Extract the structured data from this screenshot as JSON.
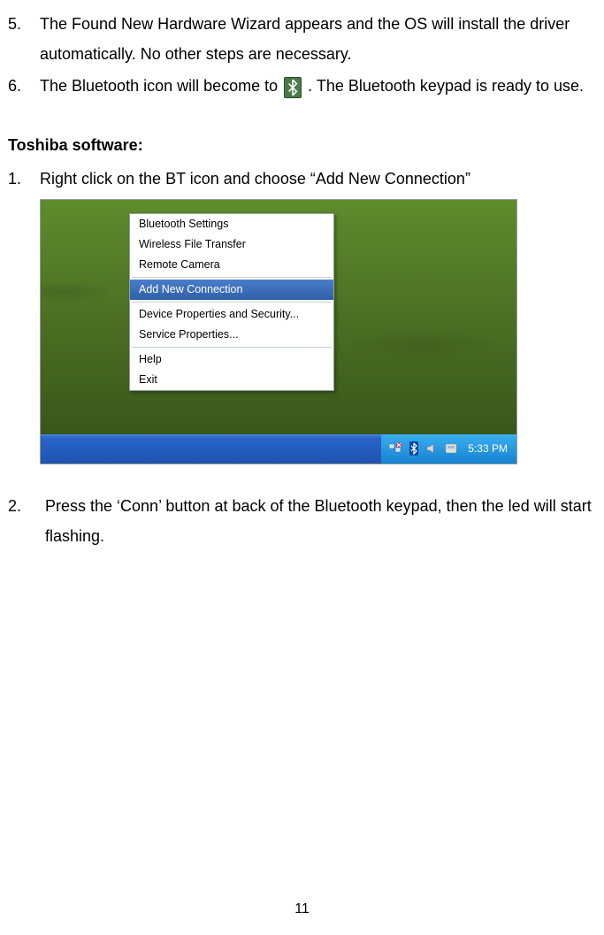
{
  "item5": {
    "num": "5.",
    "text": "The Found New Hardware Wizard appears and the OS will install the driver automatically. No other steps are necessary."
  },
  "item6": {
    "num": "6.",
    "pre": "The Bluetooth icon will become to ",
    "post": ". The Bluetooth keypad is ready to use."
  },
  "heading": "Toshiba software:",
  "t1": {
    "num": "1.",
    "text": "Right click on the BT icon and choose “Add New Connection”"
  },
  "menu": {
    "m1": "Bluetooth Settings",
    "m2": "Wireless File Transfer",
    "m3": "Remote Camera",
    "m4": "Add New Connection",
    "m5": "Device Properties and Security...",
    "m6": "Service Properties...",
    "m7": "Help",
    "m8": "Exit"
  },
  "clock": "5:33 PM",
  "t2": {
    "num": "2.",
    "text": "Press the ‘Conn’ button at back of the Bluetooth keypad, then the led will start flashing."
  },
  "page": "11"
}
